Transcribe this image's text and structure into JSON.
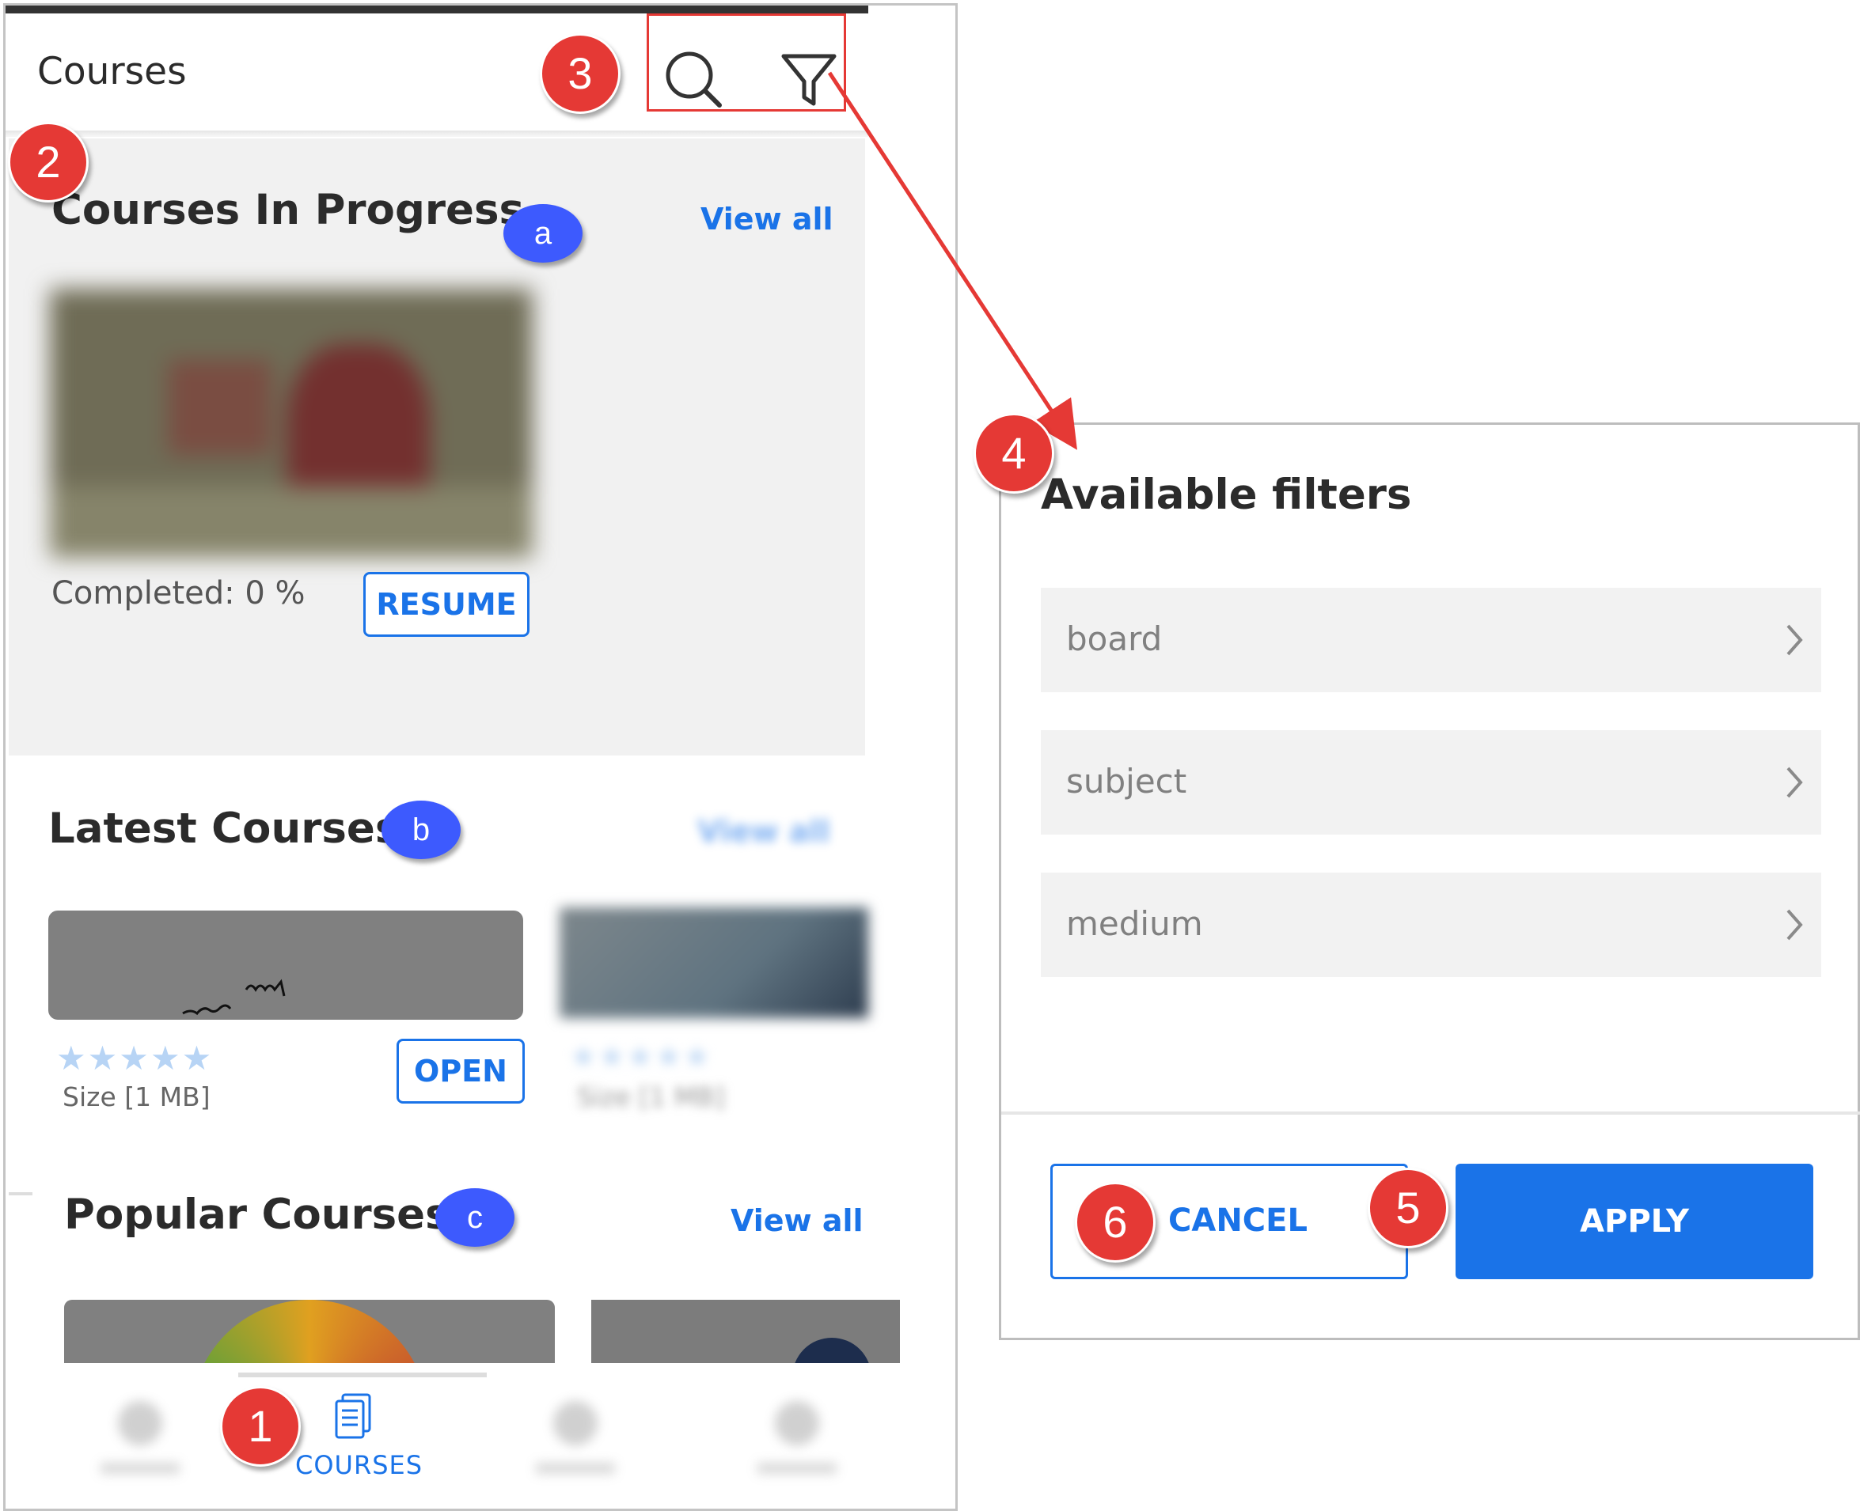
{
  "app": {
    "title": "Courses"
  },
  "in_progress": {
    "title": "Courses In Progress",
    "view_all": "View all",
    "completed": "Completed: 0 %",
    "resume_label": "RESUME"
  },
  "latest": {
    "title": "Latest Courses",
    "view_all": "View all",
    "stars": "★★★★★",
    "size": "Size [1 MB]",
    "open_label": "OPEN"
  },
  "popular": {
    "title": "Popular Courses",
    "view_all": "View all"
  },
  "bottom_nav": {
    "courses_label": "COURSES"
  },
  "filters": {
    "title": "Available filters",
    "items": [
      {
        "label": "board"
      },
      {
        "label": "subject"
      },
      {
        "label": "medium"
      }
    ],
    "cancel_label": "CANCEL",
    "apply_label": "APPLY"
  },
  "annotations": {
    "red": [
      "1",
      "2",
      "3",
      "4",
      "5",
      "6"
    ],
    "blue": [
      "a",
      "b",
      "c"
    ]
  },
  "colors": {
    "accent": "#1a73e8",
    "annotation_red": "#e53935",
    "annotation_blue": "#3d5afe"
  }
}
